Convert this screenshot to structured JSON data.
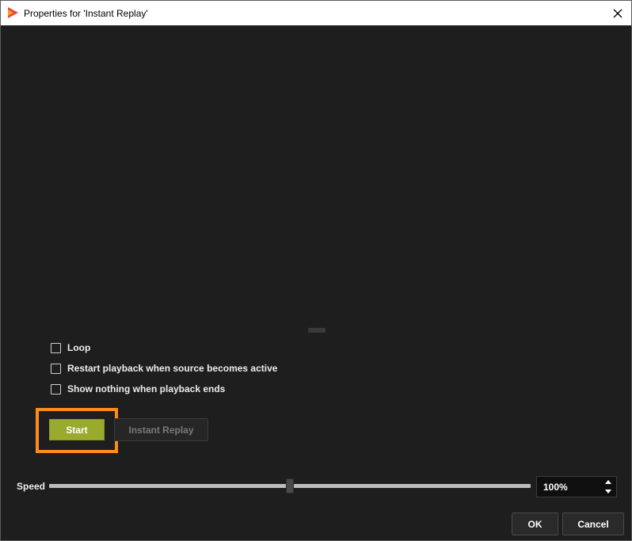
{
  "window": {
    "title": "Properties for 'Instant Replay'",
    "app_icon": "play-icon"
  },
  "options": {
    "loop_label": "Loop",
    "loop_checked": false,
    "restart_label": "Restart playback when source becomes active",
    "restart_checked": false,
    "show_nothing_label": "Show nothing when playback ends",
    "show_nothing_checked": false
  },
  "controls": {
    "start_label": "Start",
    "instant_replay_label": "Instant Replay"
  },
  "speed": {
    "label": "Speed",
    "value": "100%",
    "slider_fraction": 0.5
  },
  "footer": {
    "ok_label": "OK",
    "cancel_label": "Cancel"
  },
  "colors": {
    "start_button": "#9aaa2c",
    "highlight_border": "#ff8a1e",
    "background": "#1e1e1e"
  }
}
